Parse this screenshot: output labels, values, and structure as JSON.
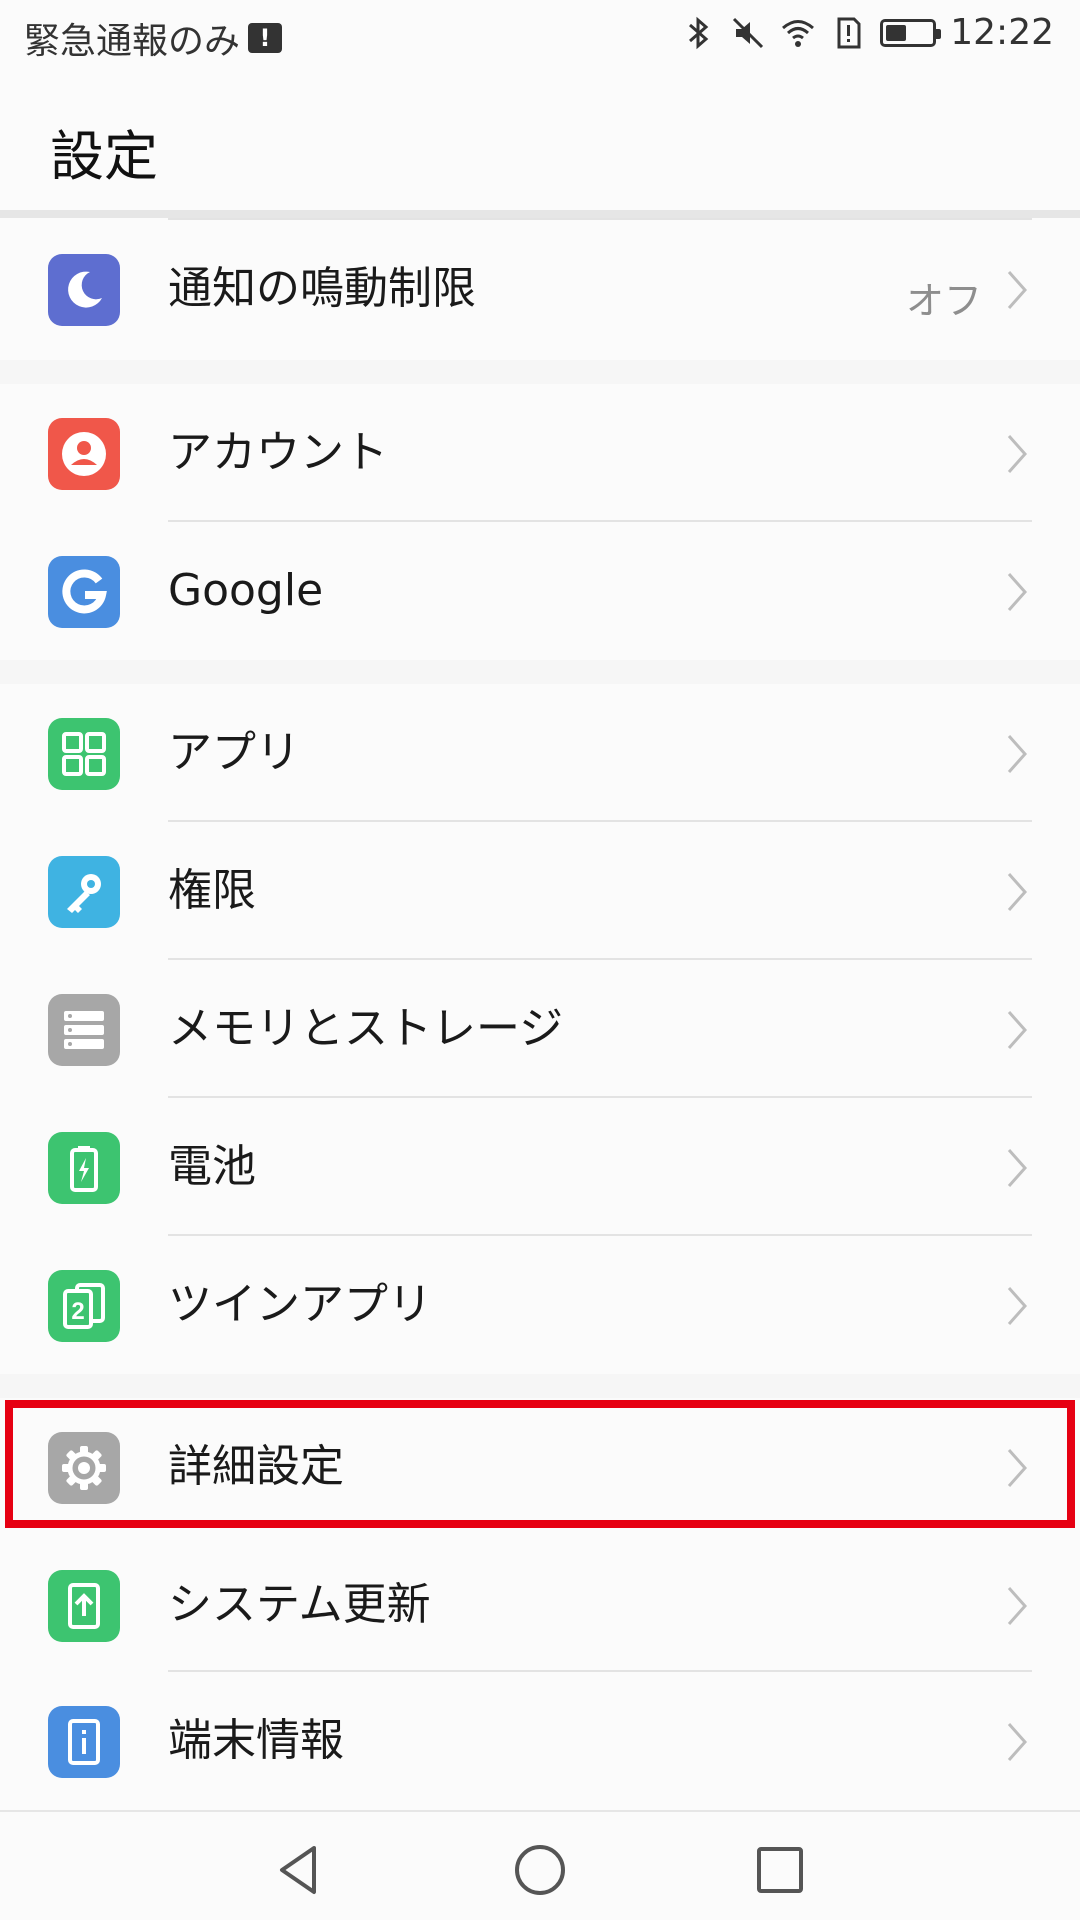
{
  "status_bar": {
    "carrier_text": "緊急通報のみ",
    "time": "12:22",
    "battery_level": 0.45
  },
  "header": {
    "title": "設定"
  },
  "groups": [
    {
      "items": [
        {
          "label": "通知の鳴動制限",
          "value": "オフ",
          "icon": "moon-icon",
          "color": "#5e6ed0"
        }
      ]
    },
    {
      "items": [
        {
          "label": "アカウント",
          "icon": "account-icon",
          "color": "#f0574a"
        },
        {
          "label": "Google",
          "icon": "google-icon",
          "color": "#4a8ee0"
        }
      ]
    },
    {
      "items": [
        {
          "label": "アプリ",
          "icon": "apps-grid-icon",
          "color": "#3dc470"
        },
        {
          "label": "権限",
          "icon": "key-icon",
          "color": "#3fb3e2"
        },
        {
          "label": "メモリとストレージ",
          "icon": "storage-icon",
          "color": "#a7a7a7"
        },
        {
          "label": "電池",
          "icon": "battery-icon",
          "color": "#3dc470"
        },
        {
          "label": "ツインアプリ",
          "icon": "twin-app-icon",
          "color": "#3dc470"
        }
      ]
    },
    {
      "items": [
        {
          "label": "詳細設定",
          "icon": "gear-icon",
          "color": "#a7a7a7"
        },
        {
          "label": "システム更新",
          "icon": "system-update-icon",
          "color": "#3dc470"
        },
        {
          "label": "端末情報",
          "icon": "device-info-icon",
          "color": "#4a8ee0"
        }
      ]
    }
  ],
  "colors": {
    "highlight": "#e60012",
    "chevron": "#bdbdbd"
  }
}
